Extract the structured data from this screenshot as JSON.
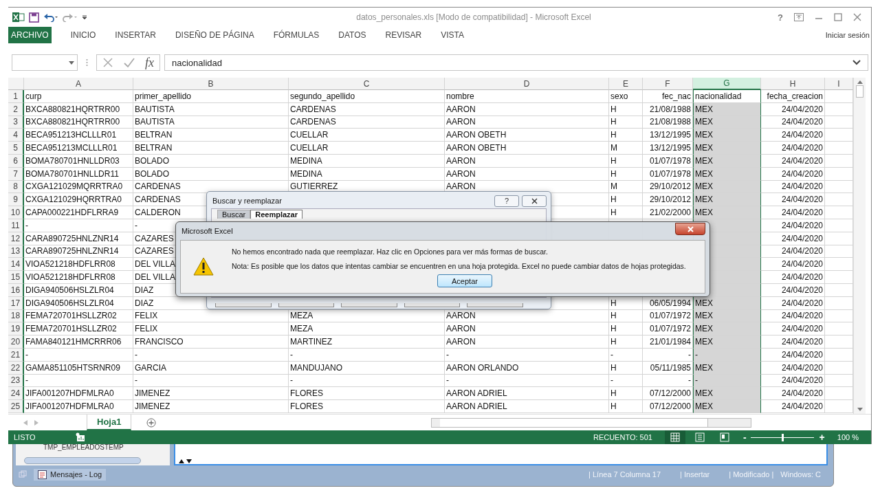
{
  "window": {
    "title": "datos_personales.xls  [Modo de compatibilidad] - Microsoft Excel",
    "help": "?",
    "account": "Iniciar sesión"
  },
  "ribbon_tabs": [
    {
      "label": "ARCHIVO",
      "kind": "file"
    },
    {
      "label": "INICIO",
      "kind": "tab"
    },
    {
      "label": "INSERTAR",
      "kind": "tab"
    },
    {
      "label": "DISEÑO DE PÁGINA",
      "kind": "tab"
    },
    {
      "label": "FÓRMULAS",
      "kind": "tab"
    },
    {
      "label": "DATOS",
      "kind": "tab"
    },
    {
      "label": "REVISAR",
      "kind": "tab"
    },
    {
      "label": "VISTA",
      "kind": "tab"
    }
  ],
  "formula_bar": {
    "function_label": "fx",
    "value": "nacionalidad"
  },
  "columns": [
    {
      "label": "A",
      "selected": false
    },
    {
      "label": "B",
      "selected": false
    },
    {
      "label": "C",
      "selected": false
    },
    {
      "label": "D",
      "selected": false
    },
    {
      "label": "E",
      "selected": false
    },
    {
      "label": "F",
      "selected": false
    },
    {
      "label": "G",
      "selected": true
    },
    {
      "label": "H",
      "selected": false
    },
    {
      "label": "I",
      "selected": false
    }
  ],
  "rows": [
    {
      "number": "1",
      "cells": [
        "curp",
        "primer_apellido",
        "segundo_apellido",
        "nombre",
        "sexo",
        "fec_nac",
        "nacionalidad",
        "fecha_creacion"
      ]
    },
    {
      "number": "2",
      "cells": [
        "BXCA880821HQRTRR00",
        "BAUTISTA",
        "CARDENAS",
        "AARON",
        "H",
        "21/08/1988",
        "MEX",
        "24/04/2020"
      ]
    },
    {
      "number": "3",
      "cells": [
        "BXCA880821HQRTRR00",
        "BAUTISTA",
        "CARDENAS",
        "AARON",
        "H",
        "21/08/1988",
        "MEX",
        "24/04/2020"
      ]
    },
    {
      "number": "4",
      "cells": [
        "BECA951213HCLLLR01",
        "BELTRAN",
        "CUELLAR",
        "AARON OBETH",
        "H",
        "13/12/1995",
        "MEX",
        "24/04/2020"
      ]
    },
    {
      "number": "5",
      "cells": [
        "BECA951213MCLLLR01",
        "BELTRAN",
        "CUELLAR",
        "AARON OBETH",
        "M",
        "13/12/1995",
        "MEX",
        "24/04/2020"
      ]
    },
    {
      "number": "6",
      "cells": [
        "BOMA780701HNLLDR03",
        "BOLADO",
        "MEDINA",
        "AARON",
        "H",
        "01/07/1978",
        "MEX",
        "24/04/2020"
      ]
    },
    {
      "number": "7",
      "cells": [
        "BOMA780701HNLLDR11",
        "BOLADO",
        "MEDINA",
        "AARON",
        "H",
        "01/07/1978",
        "MEX",
        "24/04/2020"
      ]
    },
    {
      "number": "8",
      "cells": [
        "CXGA121029MQRRTRA0",
        "CARDENAS",
        "GUTIERREZ",
        "AARON",
        "M",
        "29/10/2012",
        "MEX",
        "24/04/2020"
      ]
    },
    {
      "number": "9",
      "cells": [
        "CXGA121029HQRRTRA0",
        "CARDENAS",
        null,
        null,
        "H",
        "29/10/2012",
        "MEX",
        "24/04/2020"
      ]
    },
    {
      "number": "10",
      "cells": [
        "CAPA000221HDFLRRA9",
        "CALDERON",
        null,
        null,
        "H",
        "21/02/2000",
        "MEX",
        "24/04/2020"
      ]
    },
    {
      "number": "11",
      "cells": [
        "-",
        "-",
        null,
        null,
        null,
        null,
        null,
        "24/04/2020"
      ]
    },
    {
      "number": "12",
      "cells": [
        "CARA890725HNLZNR14",
        "CAZARES",
        null,
        null,
        null,
        null,
        null,
        "24/04/2020"
      ]
    },
    {
      "number": "13",
      "cells": [
        "CARA890725HNLZNR14",
        "CAZARES",
        null,
        null,
        null,
        null,
        null,
        "24/04/2020"
      ]
    },
    {
      "number": "14",
      "cells": [
        "VIOA521218HDFLRR08",
        "DEL VILLA",
        null,
        null,
        null,
        null,
        null,
        "24/04/2020"
      ]
    },
    {
      "number": "15",
      "cells": [
        "VIOA521218HDFLRR08",
        "DEL VILLA",
        null,
        null,
        null,
        null,
        null,
        "24/04/2020"
      ]
    },
    {
      "number": "16",
      "cells": [
        "DIGA940506HSLZLR04",
        "DIAZ",
        null,
        null,
        null,
        null,
        null,
        "24/04/2020"
      ]
    },
    {
      "number": "17",
      "cells": [
        "DIGA940506HSLZLR04",
        "DIAZ",
        null,
        null,
        "H",
        "06/05/1994",
        "MEX",
        "24/04/2020"
      ]
    },
    {
      "number": "18",
      "cells": [
        "FEMA720701HSLLZR02",
        "FELIX",
        "MEZA",
        "AARON",
        "H",
        "01/07/1972",
        "MEX",
        "24/04/2020"
      ]
    },
    {
      "number": "19",
      "cells": [
        "FEMA720701HSLLZR02",
        "FELIX",
        "MEZA",
        "AARON",
        "H",
        "01/07/1972",
        "MEX",
        "24/04/2020"
      ]
    },
    {
      "number": "20",
      "cells": [
        "FAMA840121HMCRRR06",
        "FRANCISCO",
        "MARTINEZ",
        "AARON",
        "H",
        "21/01/1984",
        "MEX",
        "24/04/2020"
      ]
    },
    {
      "number": "21",
      "cells": [
        "-",
        "-",
        "-",
        "-",
        "-",
        "-",
        "-",
        "24/04/2020"
      ]
    },
    {
      "number": "22",
      "cells": [
        "GAMA851105HTSRNR09",
        "GARCIA",
        "MANDUJANO",
        "AARON ORLANDO",
        "H",
        "05/11/1985",
        "MEX",
        "24/04/2020"
      ]
    },
    {
      "number": "23",
      "cells": [
        "-",
        "-",
        "-",
        "-",
        "-",
        "-",
        "-",
        "24/04/2020"
      ]
    },
    {
      "number": "24",
      "cells": [
        "JIFA001207HDFMLRA0",
        "JIMENEZ",
        "FLORES",
        "AARON ADRIEL",
        "H",
        "07/12/2000",
        "MEX",
        "24/04/2020"
      ]
    },
    {
      "number": "25",
      "cells": [
        "JIFA001207HDFMLRA0",
        "JIMENEZ",
        "FLORES",
        "AARON ADRIEL",
        "H",
        "07/12/2000",
        "MEX",
        "24/04/2020"
      ]
    }
  ],
  "sheet_tabs": [
    {
      "label": "Hoja1",
      "selected": true
    }
  ],
  "status_bar": {
    "mode": "LISTO",
    "count": "RECUENTO: 501",
    "views": [
      {
        "kind": "normal",
        "selected": true
      },
      {
        "kind": "layout",
        "selected": false
      },
      {
        "kind": "breaks",
        "selected": false
      }
    ],
    "zoom": {
      "minus": "-",
      "plus": "+",
      "level": 0.5,
      "reading": "100 %"
    }
  },
  "find_dialog": {
    "title": "Buscar y reemplazar",
    "help": "?",
    "tabs": [
      {
        "label": "Buscar",
        "selected": false
      },
      {
        "label": "Reemplazar",
        "selected": true
      }
    ]
  },
  "message_box": {
    "title": "Microsoft Excel",
    "lines": [
      "No hemos encontrado nada que reemplazar. Haz clic en Opciones para ver más formas de buscar.",
      "Nota: Es posible que los datos que intentas cambiar se encuentren en una hoja protegida. Excel no puede cambiar datos de hojas protegidas."
    ],
    "button": "Aceptar"
  },
  "background_window": {
    "tree_item": "TMP_EMPLEADOSTEMP",
    "tab": "Mensajes - Log",
    "status": [
      "| Línea 7 Columna 17",
      "| Insertar",
      "| Modificado |",
      "Windows: C"
    ]
  }
}
